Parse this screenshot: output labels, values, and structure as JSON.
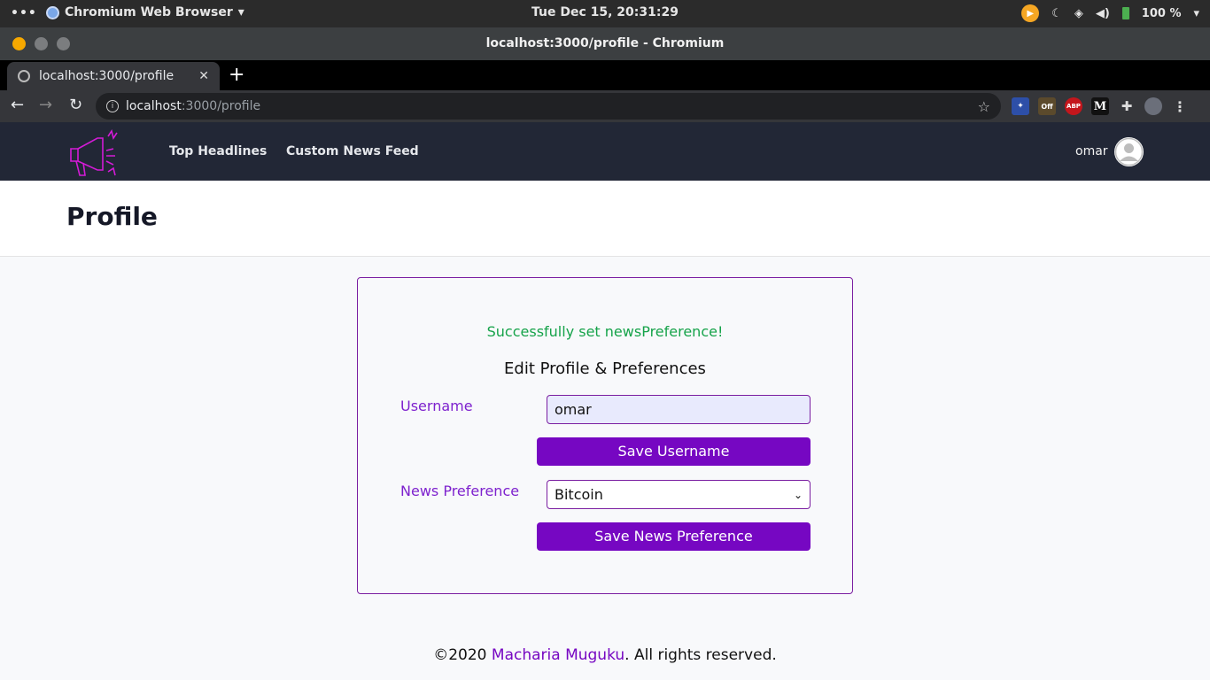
{
  "system_bar": {
    "activities": "•••",
    "app_name": "Chromium Web Browser",
    "clock": "Tue Dec 15, 20:31:29",
    "battery": "100 %"
  },
  "window": {
    "title": "localhost:3000/profile - Chromium"
  },
  "tab": {
    "title": "localhost:3000/profile",
    "close": "✕",
    "new_tab": "+"
  },
  "address_bar": {
    "host": "localhost",
    "path": ":3000/profile"
  },
  "extensions": [
    "Off",
    "ABP",
    "M"
  ],
  "site_nav": {
    "links": [
      "Top Headlines",
      "Custom News Feed"
    ],
    "user": "omar"
  },
  "page": {
    "title": "Profile"
  },
  "form": {
    "success_message": "Successfully set newsPreference!",
    "heading": "Edit Profile & Preferences",
    "username_label": "Username",
    "username_value": "omar",
    "save_username": "Save Username",
    "preference_label": "News Preference",
    "preference_value": "Bitcoin",
    "save_preference": "Save News Preference"
  },
  "footer": {
    "prefix": "©2020 ",
    "author": "Macharia Muguku",
    "suffix": ". All rights reserved."
  },
  "colors": {
    "accent": "#7607c2",
    "success": "#16a34a",
    "nav_bg": "#222736"
  }
}
